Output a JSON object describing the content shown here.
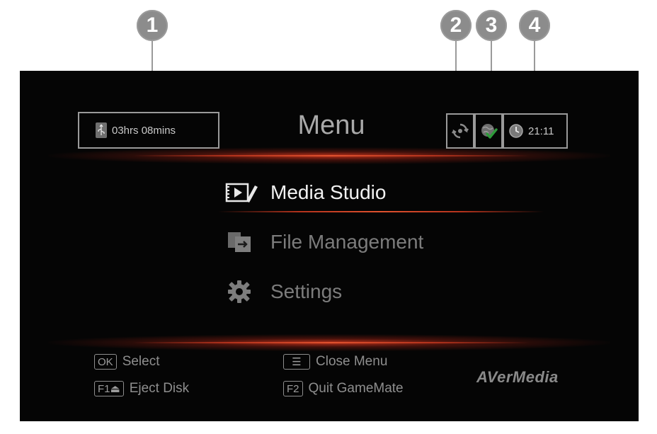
{
  "callouts": [
    "1",
    "2",
    "3",
    "4"
  ],
  "header": {
    "title": "Menu",
    "recording_time": "03hrs 08mins",
    "clock": "21:11",
    "icons": [
      "usb-drive-icon",
      "sync-icon",
      "network-connected-icon",
      "clock-icon"
    ]
  },
  "menu": {
    "items": [
      {
        "label": "Media Studio",
        "icon": "media-studio-icon",
        "selected": true
      },
      {
        "label": "File Management",
        "icon": "file-transfer-icon",
        "selected": false
      },
      {
        "label": "Settings",
        "icon": "gear-icon",
        "selected": false
      }
    ]
  },
  "footer": {
    "hints": [
      {
        "key": "OK",
        "label": "Select"
      },
      {
        "key": "F1⏏",
        "label": "Eject Disk"
      },
      {
        "key": "☰",
        "label": "Close Menu"
      },
      {
        "key": "F2",
        "label": "Quit GameMate"
      }
    ],
    "brand": "AVerMedia"
  },
  "colors": {
    "background": "#050505",
    "accent_glow": "#d6371e",
    "callout": "#8c8c8c",
    "network_ok": "#2e9a3a"
  }
}
